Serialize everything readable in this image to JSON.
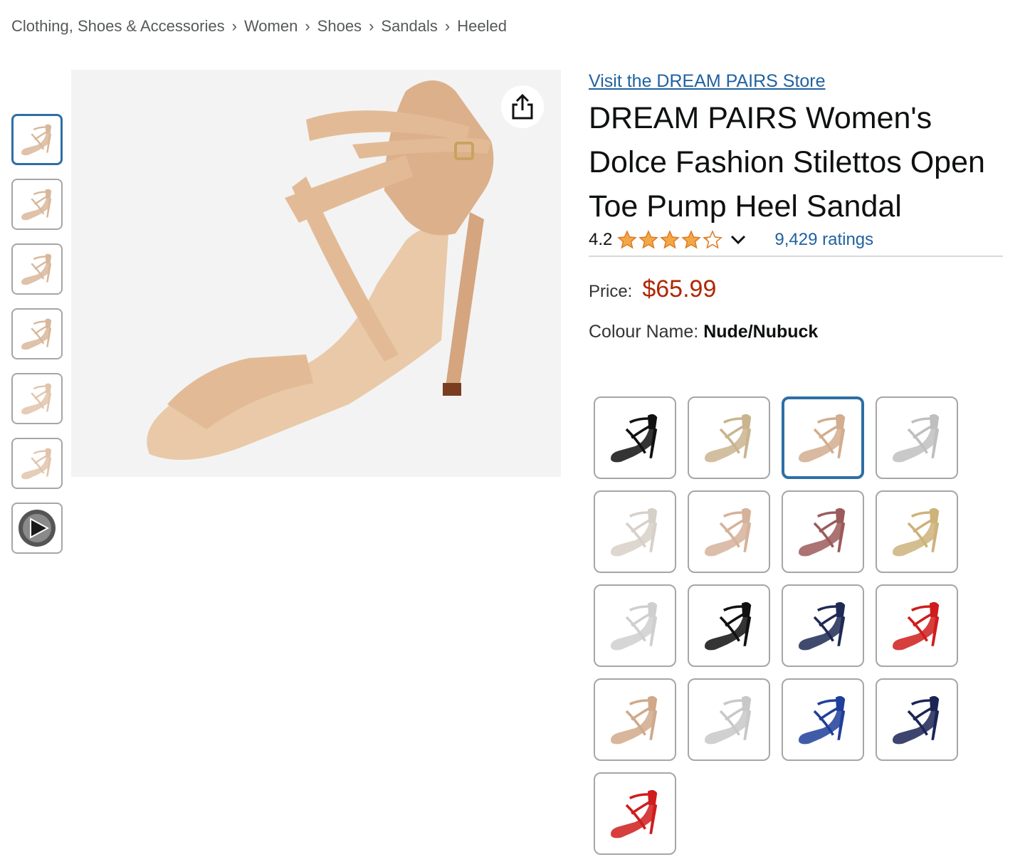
{
  "breadcrumb": [
    "Clothing, Shoes & Accessories",
    "Women",
    "Shoes",
    "Sandals",
    "Heeled"
  ],
  "breadcrumb_sep": "›",
  "store_link": "Visit the DREAM PAIRS Store",
  "title": "DREAM PAIRS Women's Dolce Fashion Stilettos Open Toe Pump Heel Sandal",
  "rating": {
    "value": "4.2",
    "stars_filled": 4.2,
    "count": "9,429 ratings"
  },
  "price": {
    "label": "Price:",
    "value": "$65.99"
  },
  "colour": {
    "label": "Colour Name:",
    "value": "Nude/Nubuck"
  },
  "colors": {
    "accent": "#2f6ea5",
    "price": "#b12704",
    "link": "#2162a1",
    "star": "#f3a847"
  },
  "thumbnails": [
    {
      "color": "#d8b79a",
      "selected": true
    },
    {
      "color": "#d8b79a"
    },
    {
      "color": "#d8b79a"
    },
    {
      "color": "#d8b79a"
    },
    {
      "color": "#e1c4ab"
    },
    {
      "color": "#e1c4ab"
    },
    {
      "color": "#555555",
      "video": true
    }
  ],
  "swatches": [
    {
      "color": "#111111"
    },
    {
      "color": "#c9b48e"
    },
    {
      "color": "#d2ad8e",
      "selected": true
    },
    {
      "color": "#bfbfbf"
    },
    {
      "color": "#d7d0c8"
    },
    {
      "color": "#d6b29a"
    },
    {
      "color": "#9c5a5a"
    },
    {
      "color": "#cdb27a"
    },
    {
      "color": "#cfcfcf"
    },
    {
      "color": "#111111"
    },
    {
      "color": "#1f2a55"
    },
    {
      "color": "#d01c1c"
    },
    {
      "color": "#d0a98a"
    },
    {
      "color": "#c8c8c8"
    },
    {
      "color": "#1f3f9a"
    },
    {
      "color": "#1b2555"
    },
    {
      "color": "#d01c1c"
    }
  ]
}
